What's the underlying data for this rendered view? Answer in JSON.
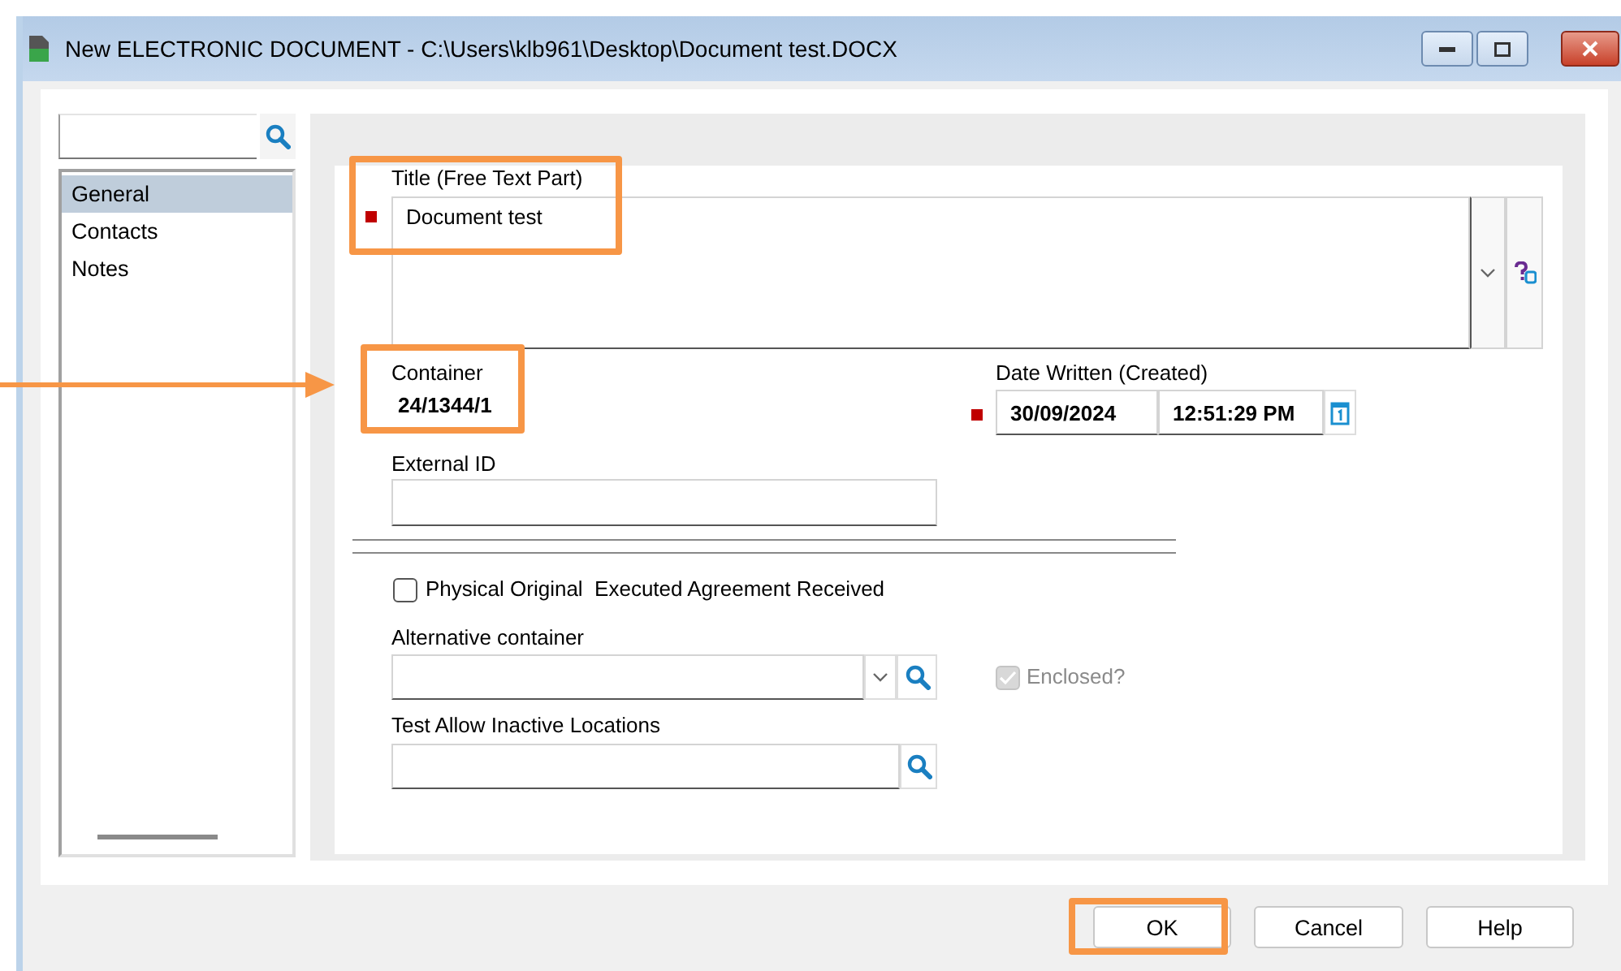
{
  "window": {
    "title": "New ELECTRONIC DOCUMENT - C:\\Users\\klb961\\Desktop\\Document test.DOCX"
  },
  "sidebar": {
    "items": [
      {
        "label": "General",
        "selected": true
      },
      {
        "label": "Contacts",
        "selected": false
      },
      {
        "label": "Notes",
        "selected": false
      }
    ]
  },
  "form": {
    "title_field": {
      "label": "Title (Free Text Part)",
      "value": "Document test",
      "required": true,
      "highlighted": true
    },
    "container": {
      "label": "Container",
      "value": "24/1344/1",
      "highlighted": true,
      "pointer_arrow": true
    },
    "date_written": {
      "label": "Date Written (Created)",
      "date": "30/09/2024",
      "time": "12:51:29 PM",
      "required": true
    },
    "external_id": {
      "label": "External ID"
    },
    "physical_original": {
      "label": "Physical Original  Executed Agreement Received",
      "checked": false
    },
    "alternative_container": {
      "label": "Alternative container"
    },
    "enclosed": {
      "label": "Enclosed?",
      "checked": true,
      "disabled": true
    },
    "test_allow": {
      "label": "Test Allow Inactive Locations"
    }
  },
  "buttons": [
    {
      "label": "OK",
      "highlighted": true
    },
    {
      "label": "Cancel",
      "highlighted": false
    },
    {
      "label": "Help",
      "highlighted": false
    }
  ]
}
